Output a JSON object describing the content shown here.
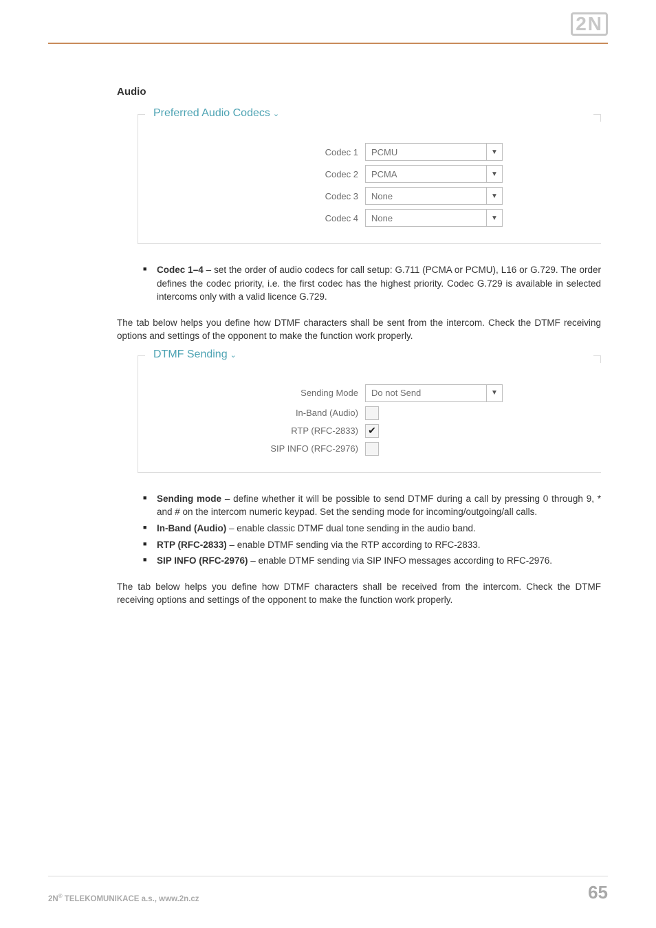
{
  "brand": "2N",
  "heading": "Audio",
  "codec_section": {
    "legend": "Preferred Audio Codecs",
    "rows": [
      {
        "label": "Codec 1",
        "value": "PCMU"
      },
      {
        "label": "Codec 2",
        "value": "PCMA"
      },
      {
        "label": "Codec 3",
        "value": "None"
      },
      {
        "label": "Codec 4",
        "value": "None"
      }
    ]
  },
  "codec_bullet": {
    "title": "Codec 1–4",
    "text": " – set the order of audio codecs for call setup: G.711 (PCMA or PCMU), L16 or G.729. The order defines the codec priority, i.e. the first codec has the highest priority. Codec G.729 is available in selected intercoms only with a valid licence G.729."
  },
  "dtmf_send_intro": "The tab below helps you define how DTMF characters shall be sent from the intercom. Check the DTMF receiving options and settings of the opponent to make the function work properly.",
  "dtmf_send_section": {
    "legend": "DTMF Sending",
    "mode_label": "Sending Mode",
    "mode_value": "Do not Send",
    "checks": [
      {
        "label": "In-Band (Audio)",
        "checked": false
      },
      {
        "label": "RTP (RFC-2833)",
        "checked": true
      },
      {
        "label": "SIP INFO (RFC-2976)",
        "checked": false
      }
    ]
  },
  "dtmf_send_bullets": [
    {
      "title": "Sending mode",
      "text": " – define whether it will be possible to send DTMF during a call by pressing 0 through 9, * and # on the intercom numeric keypad. Set the sending mode for incoming/outgoing/all calls."
    },
    {
      "title": "In-Band (Audio)",
      "text": " – enable classic DTMF dual tone sending in the audio band."
    },
    {
      "title": "RTP (RFC-2833)",
      "text": " – enable DTMF sending via the RTP according to RFC-2833."
    },
    {
      "title": "SIP INFO (RFC-2976)",
      "text": " – enable DTMF sending via SIP INFO messages according to RFC-2976."
    }
  ],
  "dtmf_recv_intro": "The tab below helps you define how DTMF characters shall be received from the intercom. Check the DTMF receiving options and settings of the opponent to make the function work properly.",
  "footer": {
    "company_prefix": "2N",
    "company_rest": " TELEKOMUNIKACE a.s., www.2n.cz",
    "page": "65"
  }
}
